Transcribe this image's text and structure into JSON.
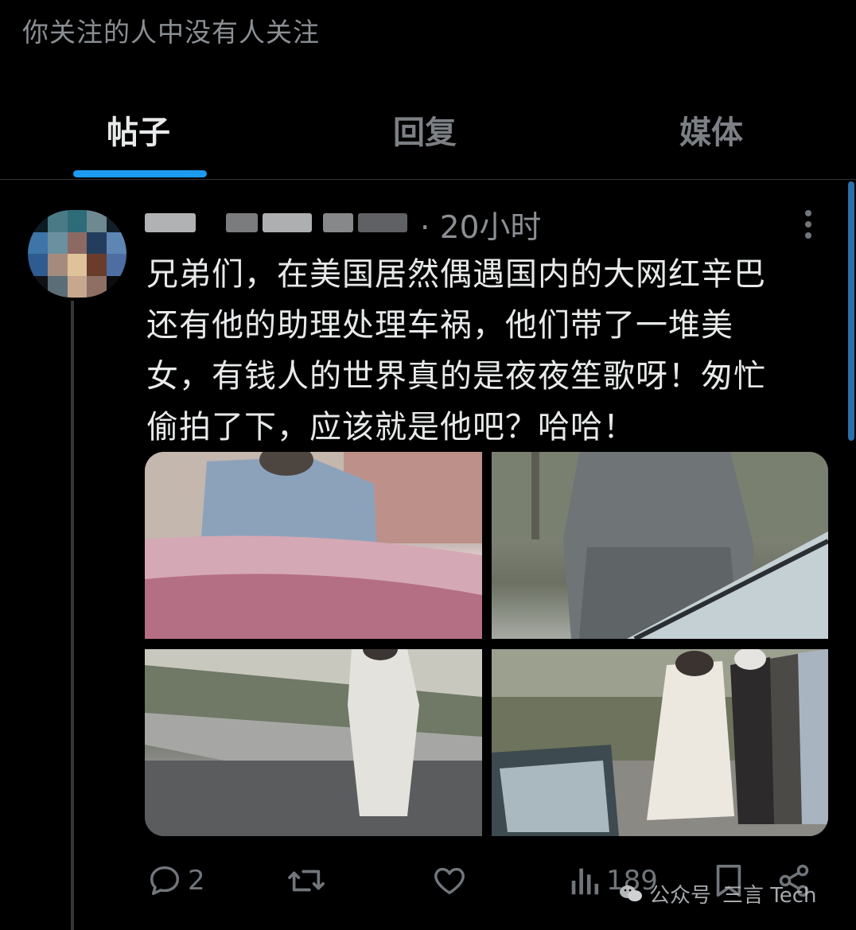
{
  "profile": {
    "followers_note": "你关注的人中没有人关注"
  },
  "tabs": [
    {
      "label": "帖子",
      "active": true
    },
    {
      "label": "回复",
      "active": false
    },
    {
      "label": "媒体",
      "active": false
    }
  ],
  "post": {
    "time": "· 20小时",
    "text": "兄弟们，在美国居然偶遇国内的大网红辛巴\n还有他的助理处理车祸，他们带了一堆美\n女，有钱人的世界真的是夜夜笙歌呀！匆忙\n偷拍了下，应该就是他吧？哈哈！",
    "images": [
      {
        "icon": "photo-man-denim-jacket"
      },
      {
        "icon": "photo-man-grey-hoodie"
      },
      {
        "icon": "photo-woman-white-outfit"
      },
      {
        "icon": "photo-group-by-car"
      }
    ],
    "actions": {
      "replies": "2",
      "reposts": "",
      "likes": "",
      "views": "189"
    }
  },
  "watermark": {
    "platform": "公众号",
    "account": "三言 Tech"
  },
  "colors": {
    "accent": "#1d9bf0",
    "muted_text": "#71767b",
    "background": "#000000",
    "text": "#e7e9ea"
  }
}
